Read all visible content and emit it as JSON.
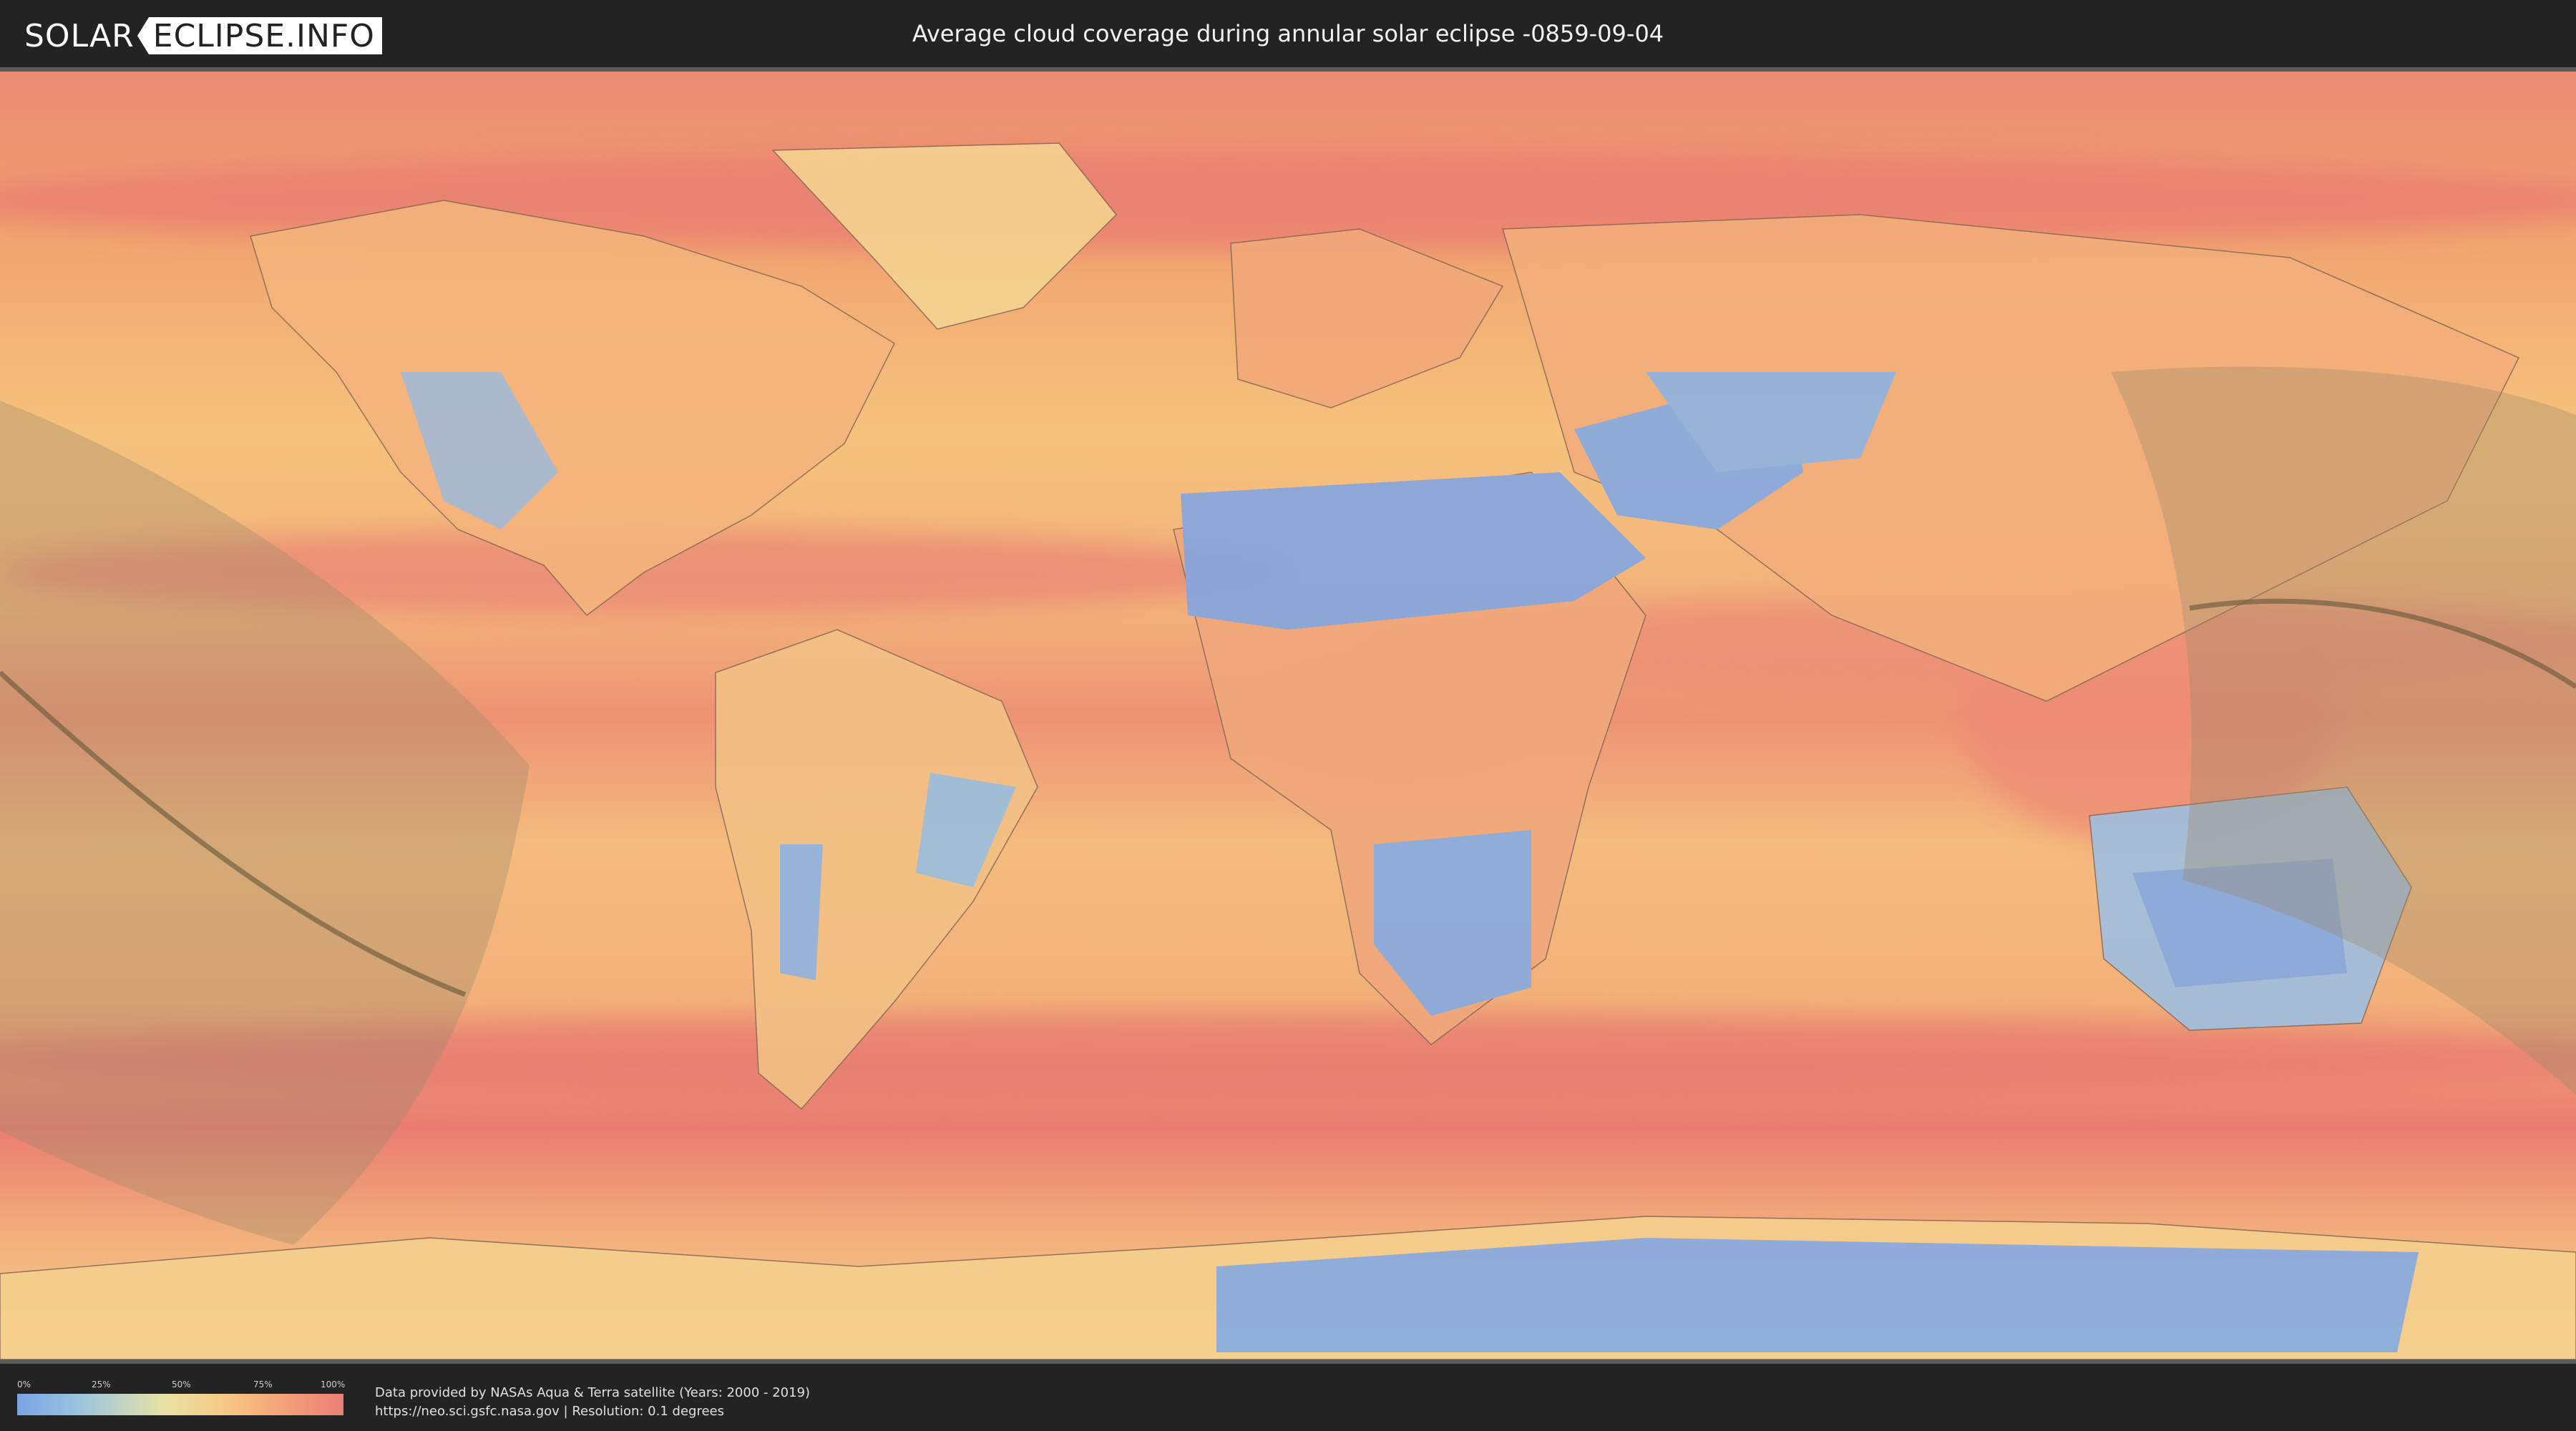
{
  "header": {
    "logo_left": "SOLAR",
    "logo_right": "ECLIPSE.INFO",
    "title": "Average cloud coverage during annular solar eclipse -0859-09-04"
  },
  "legend": {
    "ticks": [
      "0%",
      "25%",
      "50%",
      "75%",
      "100%"
    ],
    "colors": [
      "#7aa3e6",
      "#e9e2a6",
      "#ec7f78"
    ]
  },
  "credits": {
    "line1": "Data provided by NASAs Aqua & Terra satellite (Years: 2000 - 2019)",
    "line2": "https://neo.sci.gsfc.nasa.gov | Resolution: 0.1 degrees"
  },
  "map": {
    "background_color": "#f4b07a",
    "clear_sky_color": "#82a8e3",
    "cloudy_color": "#e97c78",
    "eclipse_band_color": "#9a8a6a",
    "central_line_color": "#6b5a3e"
  }
}
